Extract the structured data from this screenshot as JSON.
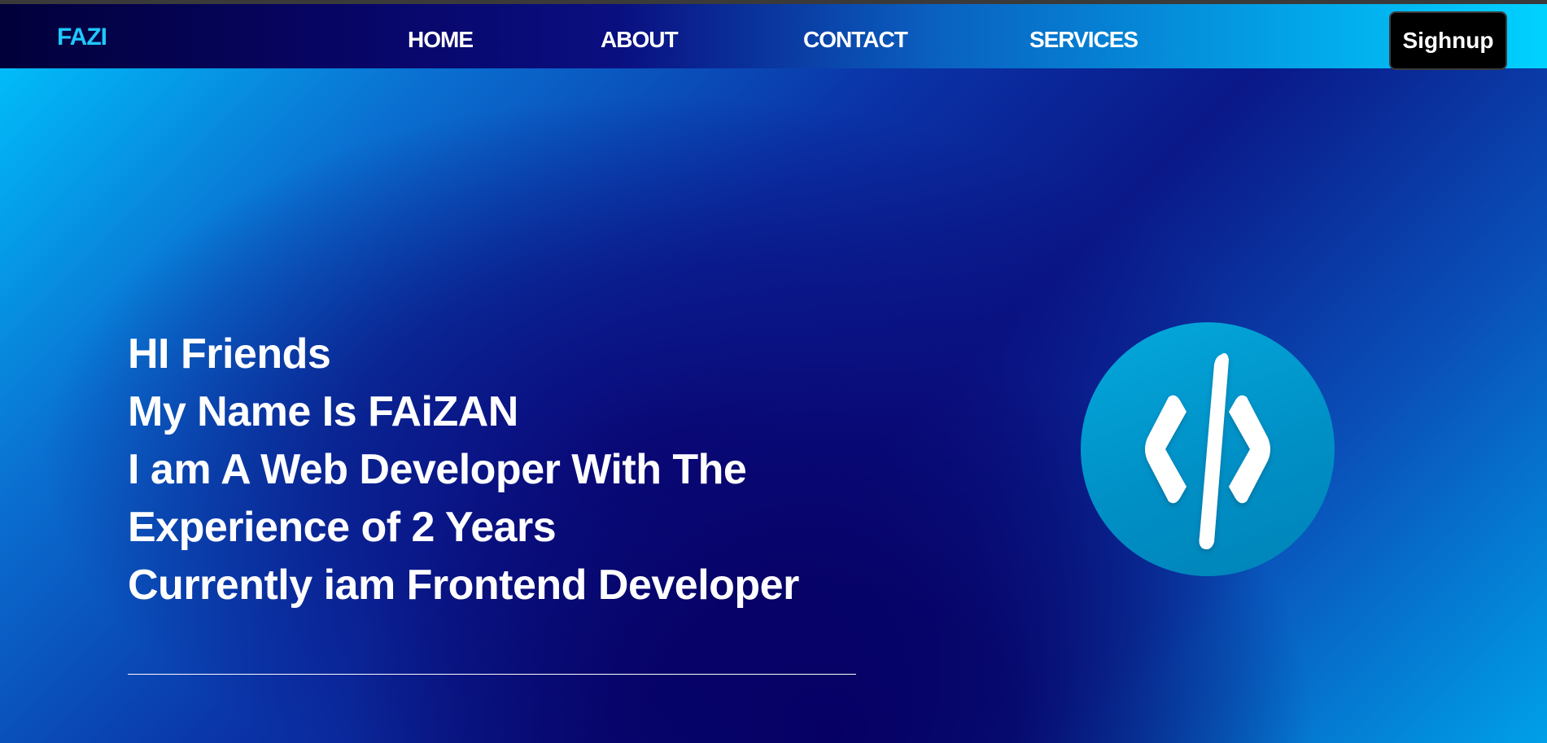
{
  "navbar": {
    "brand": "FAZI",
    "links": [
      {
        "label": "HOME"
      },
      {
        "label": "ABOUT"
      },
      {
        "label": "CONTACT"
      },
      {
        "label": "SERVICES"
      }
    ],
    "signup_label": "Sighnup"
  },
  "hero": {
    "lines": [
      "HI Friends",
      "My Name Is FAiZAN",
      "I am A Web Developer With The",
      "Experience of 2 Years",
      "Currently iam Frontend Developer"
    ]
  },
  "logo": {
    "icon": "code-icon",
    "circle_color": "#0098cf"
  },
  "colors": {
    "brand": "#1fc8ff",
    "nav_text": "#ffffff",
    "button_bg": "#000000"
  }
}
